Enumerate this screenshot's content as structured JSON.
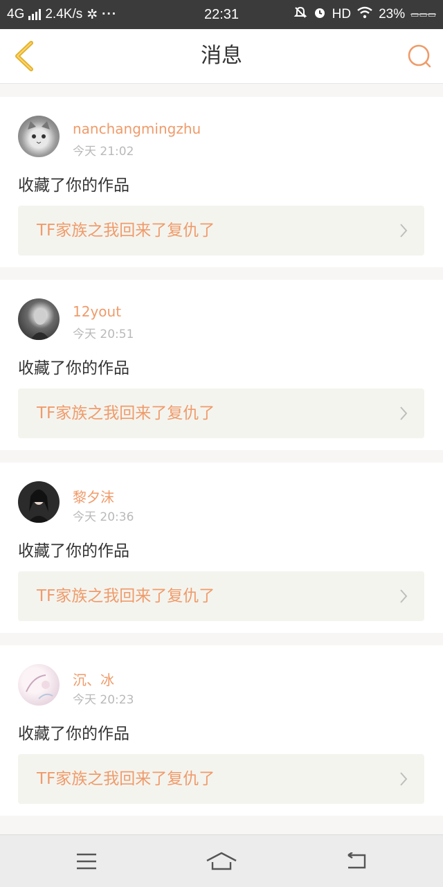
{
  "status_bar": {
    "network": "4G",
    "speed": "2.4K/s",
    "more": "···",
    "time": "22:31",
    "hd": "HD",
    "battery": "23%",
    "icons": [
      "signal-icon",
      "settings-gear-icon",
      "mute-bell-icon",
      "alarm-icon",
      "wifi-icon"
    ]
  },
  "header": {
    "title": "消息",
    "back_icon": "chevron-left-icon",
    "search_icon": "search-icon"
  },
  "colors": {
    "accent": "#ef9b6a",
    "back_icon": "#e2b130",
    "statusbar_bg": "#3b3b3b",
    "page_bg": "#f7f6f4",
    "link_bg": "#f4f4ef"
  },
  "messages": [
    {
      "user": "nanchangmingzhu",
      "time": "今天 21:02",
      "action": "收藏了你的作品",
      "work_title": "TF家族之我回来了复仇了"
    },
    {
      "user": "12yout",
      "time": "今天 20:51",
      "action": "收藏了你的作品",
      "work_title": "TF家族之我回来了复仇了"
    },
    {
      "user": "黎夕沫",
      "time": "今天 20:36",
      "action": "收藏了你的作品",
      "work_title": "TF家族之我回来了复仇了"
    },
    {
      "user": "沉、冰",
      "time": "今天 20:23",
      "action": "收藏了你的作品",
      "work_title": "TF家族之我回来了复仇了"
    }
  ],
  "nav_bar": {
    "icons": [
      "menu-icon",
      "home-icon",
      "back-icon"
    ]
  }
}
